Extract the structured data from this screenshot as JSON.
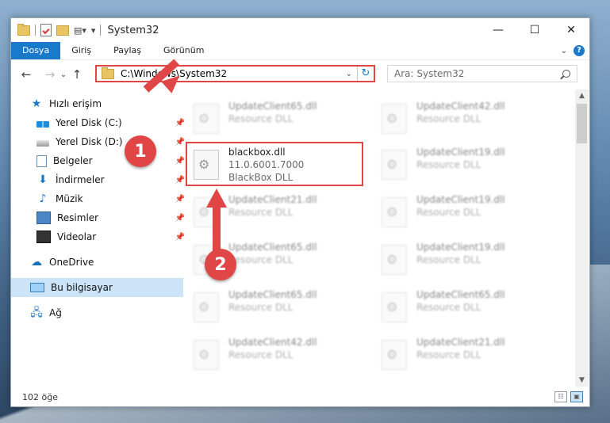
{
  "window": {
    "title": "System32"
  },
  "titlebar": {
    "view_glyph": "▤▾",
    "qa_dropdown": "▾",
    "minimize": "—",
    "maximize": "☐",
    "close": "✕"
  },
  "ribbon": {
    "tabs": [
      "Dosya",
      "Giriş",
      "Paylaş",
      "Görünüm"
    ],
    "active_tab": "Dosya",
    "expand_glyph": "⌄",
    "help_glyph": "?"
  },
  "nav": {
    "back": "←",
    "forward": "→",
    "dropdown": "⌄",
    "up": "↑",
    "refresh_glyph": "↻",
    "addr_dropdown_glyph": "⌄"
  },
  "address": {
    "path": "C:\\Windows\\System32"
  },
  "search": {
    "placeholder": "Ara: System32"
  },
  "sidebar": {
    "pin_glyph": "📌",
    "items": [
      {
        "label": "Hızlı erişim",
        "icon": "quick-access-star-icon",
        "glyph": "★"
      },
      {
        "label": "Yerel Disk (C:)",
        "icon": "windows-drive-icon"
      },
      {
        "label": "Yerel Disk (D:)",
        "icon": "drive-icon"
      },
      {
        "label": "Belgeler",
        "icon": "documents-icon"
      },
      {
        "label": "İndirmeler",
        "icon": "download-arrow-icon",
        "glyph": "⬇"
      },
      {
        "label": "Müzik",
        "icon": "music-note-icon",
        "glyph": "♪"
      },
      {
        "label": "Resimler",
        "icon": "pictures-icon"
      },
      {
        "label": "Videolar",
        "icon": "videos-icon"
      },
      {
        "label": "OneDrive",
        "icon": "cloud-icon",
        "glyph": "☁"
      },
      {
        "label": "Bu bilgisayar",
        "icon": "computer-icon",
        "selected": true
      },
      {
        "label": "Ağ",
        "icon": "network-icon",
        "glyph": "🖧"
      }
    ]
  },
  "files": [
    {
      "name": "UpdateClient65.dll",
      "line2": "Resource DLL",
      "blurred": true
    },
    {
      "name": "UpdateClient42.dll",
      "line2": "Resource DLL",
      "blurred": true
    },
    {
      "name": "blackbox.dll",
      "line2": "11.0.6001.7000",
      "line3": "BlackBox DLL",
      "blurred": false,
      "highlighted": true
    },
    {
      "name": "UpdateClient19.dll",
      "line2": "Resource DLL",
      "blurred": true
    },
    {
      "name": "UpdateClient21.dll",
      "line2": "Resource DLL",
      "blurred": true
    },
    {
      "name": "UpdateClient19.dll",
      "line2": "Resource DLL",
      "blurred": true
    },
    {
      "name": "UpdateClient65.dll",
      "line2": "Resource DLL",
      "blurred": true
    },
    {
      "name": "UpdateClient19.dll",
      "line2": "Resource DLL",
      "blurred": true
    },
    {
      "name": "UpdateClient65.dll",
      "line2": "Resource DLL",
      "blurred": true
    },
    {
      "name": "UpdateClient65.dll",
      "line2": "Resource DLL",
      "blurred": true
    },
    {
      "name": "UpdateClient42.dll",
      "line2": "Resource DLL",
      "blurred": true
    },
    {
      "name": "UpdateClient21.dll",
      "line2": "Resource DLL",
      "blurred": true
    }
  ],
  "scrollbar": {
    "up": "▲",
    "down": "▼"
  },
  "status": {
    "item_count": "102 öğe",
    "details_view_glyph": "☷",
    "icons_view_glyph": "▣"
  },
  "annotations": {
    "badge1": "1",
    "badge2": "2",
    "color": "#e04646"
  },
  "colors": {
    "accent": "#1979ca",
    "highlight": "#e04646",
    "selection": "#cce4f7"
  }
}
